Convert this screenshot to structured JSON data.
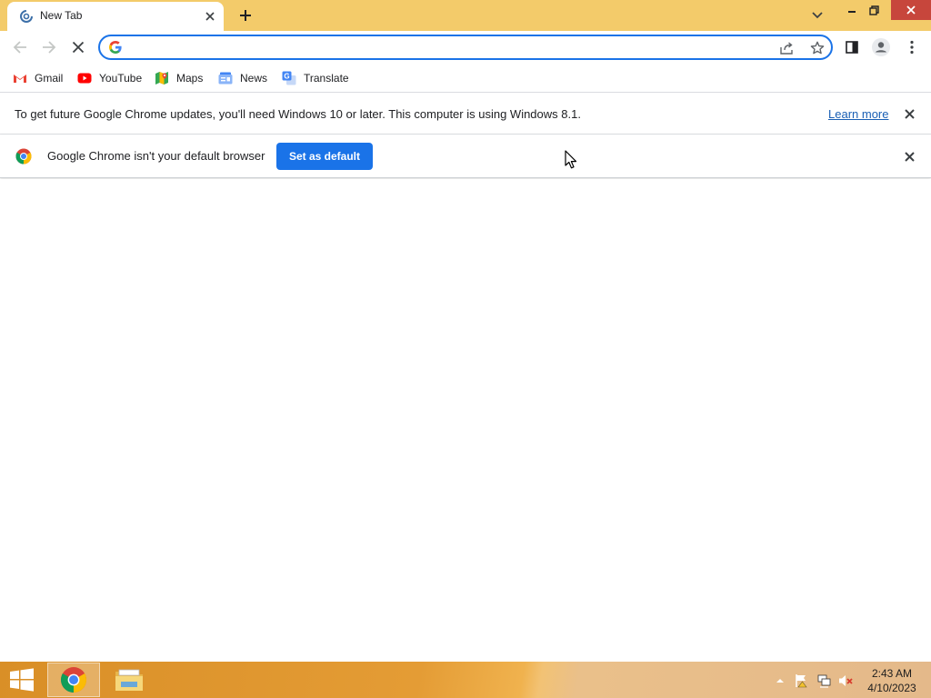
{
  "window": {
    "tab_title": "New Tab",
    "tab_favicon": "loading-spinner-icon"
  },
  "omnibox": {
    "value": "",
    "placeholder": ""
  },
  "bookmarks": [
    {
      "label": "Gmail",
      "icon": "gmail-icon"
    },
    {
      "label": "YouTube",
      "icon": "youtube-icon"
    },
    {
      "label": "Maps",
      "icon": "maps-icon"
    },
    {
      "label": "News",
      "icon": "news-icon"
    },
    {
      "label": "Translate",
      "icon": "translate-icon"
    }
  ],
  "infobars": {
    "updates": {
      "message": "To get future Google Chrome updates, you'll need Windows 10 or later. This computer is using Windows 8.1.",
      "link_label": "Learn more"
    },
    "default_browser": {
      "message": "Google Chrome isn't your default browser",
      "button_label": "Set as default"
    }
  },
  "taskbar": {
    "clock_time": "2:43 AM",
    "clock_date": "4/10/2023",
    "pinned": [
      "chrome-icon",
      "file-explorer-icon"
    ]
  },
  "colors": {
    "titlebar": "#f3cb6a",
    "accent": "#1a73e8",
    "window_close": "#c7463c",
    "link": "#1a5fb4"
  }
}
